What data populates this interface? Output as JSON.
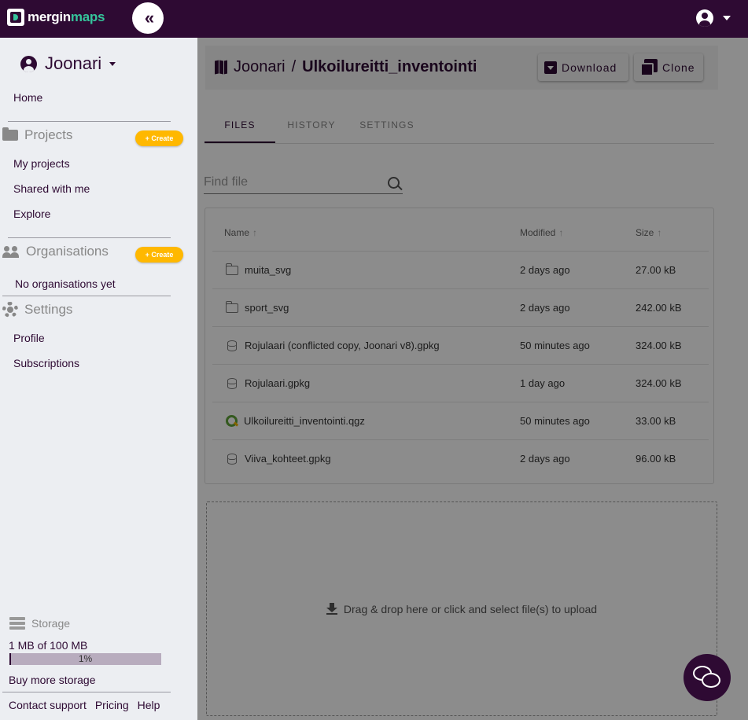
{
  "topbar": {
    "logo_part1": "mergin",
    "logo_part2": "maps",
    "collapse_glyph": "«"
  },
  "sidebar": {
    "workspace_name": "Joonari",
    "home": "Home",
    "projects_title": "Projects",
    "create_label": "+ Create",
    "projects_links": [
      "My projects",
      "Shared with me",
      "Explore"
    ],
    "organisations_title": "Organisations",
    "no_orgs": "No organisations yet",
    "settings_title": "Settings",
    "settings_links": [
      "Profile",
      "Subscriptions"
    ],
    "storage": {
      "title": "Storage",
      "usage": "1 MB of 100 MB",
      "percent_label": "1%",
      "percent": 0.01,
      "buy_more": "Buy more storage"
    },
    "footer_links": [
      "Contact support",
      "Pricing",
      "Help"
    ]
  },
  "header": {
    "workspace": "Joonari",
    "separator": "/",
    "project": "Ulkoilureitti_inventointi",
    "download_label": "Download",
    "clone_label": "Clone"
  },
  "tabs": [
    "FILES",
    "HISTORY",
    "SETTINGS"
  ],
  "search": {
    "placeholder": "Find file"
  },
  "table": {
    "columns": [
      "Name",
      "Modified",
      "Size"
    ],
    "rows": [
      {
        "icon": "folder-icon",
        "name": "muita_svg",
        "modified": "2 days ago",
        "size": "27.00 kB"
      },
      {
        "icon": "folder-icon",
        "name": "sport_svg",
        "modified": "2 days ago",
        "size": "242.00 kB"
      },
      {
        "icon": "database-icon",
        "name": "Rojulaari (conflicted copy, Joonari v8).gpkg",
        "modified": "50 minutes ago",
        "size": "324.00 kB"
      },
      {
        "icon": "database-icon",
        "name": "Rojulaari.gpkg",
        "modified": "1 day ago",
        "size": "324.00 kB"
      },
      {
        "icon": "qgis-icon",
        "name": "Ulkoilureitti_inventointi.qgz",
        "modified": "50 minutes ago",
        "size": "33.00 kB"
      },
      {
        "icon": "database-icon",
        "name": "Viiva_kohteet.gpkg",
        "modified": "2 days ago",
        "size": "96.00 kB"
      }
    ]
  },
  "dropzone": {
    "text": "Drag & drop here or click and select file(s) to upload"
  },
  "colors": {
    "brand": "#2e0a33",
    "accent": "#35c49b",
    "create_button": "#ffb800"
  }
}
